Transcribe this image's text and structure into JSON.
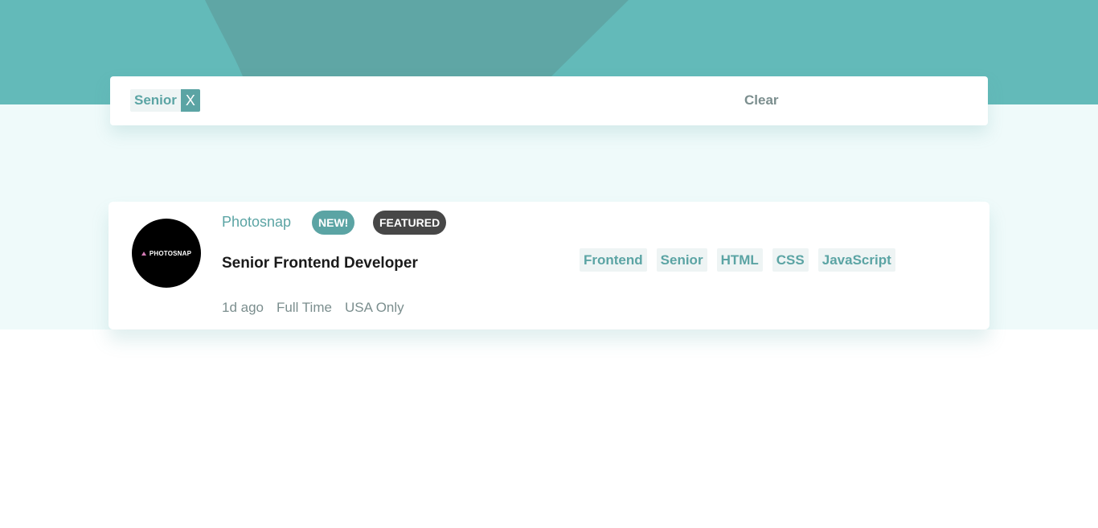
{
  "colors": {
    "primary": "#5ba4a4",
    "header_bg": "#63bab9",
    "light_bg": "#effafa",
    "tag_bg": "#eef4f4",
    "featured_bg": "#474747",
    "muted_text": "#7b8e8e"
  },
  "filter_bar": {
    "filters": [
      {
        "label": "Senior",
        "remove_label": "X"
      }
    ],
    "clear_label": "Clear"
  },
  "jobs": [
    {
      "logo_text": "PHOTOSNAP",
      "company": "Photosnap",
      "new_label": "NEW!",
      "featured_label": "FEATURED",
      "position": "Senior Frontend Developer",
      "posted_at": "1d ago",
      "contract": "Full Time",
      "location": "USA Only",
      "tags": [
        "Frontend",
        "Senior",
        "HTML",
        "CSS",
        "JavaScript"
      ]
    }
  ]
}
